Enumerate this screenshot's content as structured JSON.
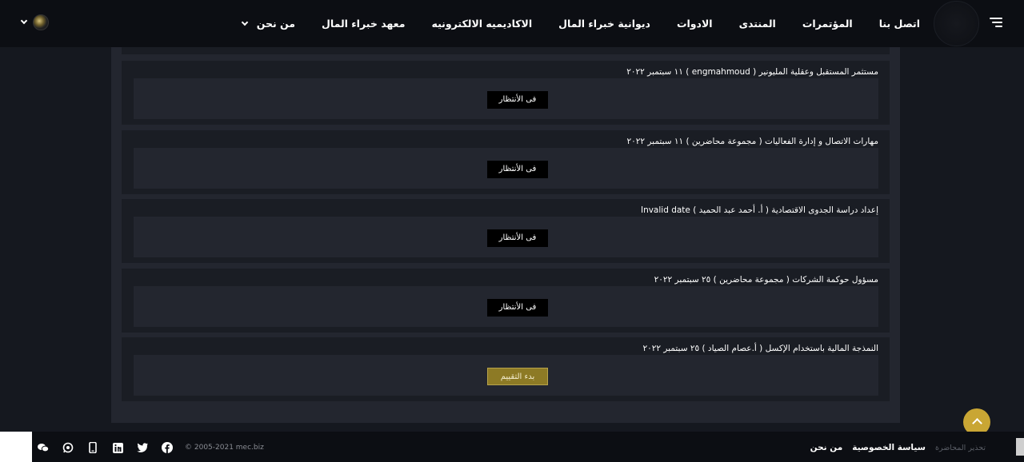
{
  "header": {
    "nav": [
      {
        "label": "من نحن",
        "has_dropdown": true
      },
      {
        "label": "معهد خبراء المال"
      },
      {
        "label": "الاكاديميه الالكترونيه"
      },
      {
        "label": "ديوانية خبراء المال"
      },
      {
        "label": "الادوات"
      },
      {
        "label": "المنتدى"
      },
      {
        "label": "المؤتمرات"
      },
      {
        "label": "اتصل بنا"
      }
    ],
    "menu_icon": "hamburger-icon",
    "user_menu_icon": "chevron-down-icon"
  },
  "courses": [
    {
      "title": "مستثمر المستقبل وعقلية المليونير ( engmahmoud ) ١١ سبتمبر ٢٠٢٢",
      "button": "فى الأنتظار",
      "status": "waiting"
    },
    {
      "title": "مهارات الاتصال و إدارة الفعاليات ( مجموعة محاضرين ) ١١ سبتمبر ٢٠٢٢",
      "button": "فى الأنتظار",
      "status": "waiting"
    },
    {
      "title": "إعداد دراسة الجدوى الاقتصادية ( أ. أحمد عبد الحميد ) Invalid date",
      "button": "فى الأنتظار",
      "status": "waiting"
    },
    {
      "title": "مسؤول حوكمة الشركات ( مجموعة محاضرين ) ٢٥ سبتمبر ٢٠٢٢",
      "button": "فى الأنتظار",
      "status": "waiting"
    },
    {
      "title": "النمذجة المالية باستخدام الإكسل ( أ.عصام الصياد ) ٢٥ سبتمبر ٢٠٢٢",
      "button": "بدء التقييم",
      "status": "start"
    }
  ],
  "footer": {
    "about": "من نحن",
    "privacy": "سياسة الخصوصية",
    "muted": "تحذير المحاضرة",
    "copyright": "© 2005-2021 mec.biz",
    "social_icons": [
      "wechat-icon",
      "whatsapp-icon",
      "phone-icon",
      "linkedin-icon",
      "twitter-icon",
      "facebook-icon"
    ]
  },
  "colors": {
    "header_bg": "#0c0e13",
    "panel_bg": "#23262f",
    "card_bg": "#1a1d24",
    "accent_gold": "#c9a634",
    "button_gold": "#8d7a25"
  }
}
